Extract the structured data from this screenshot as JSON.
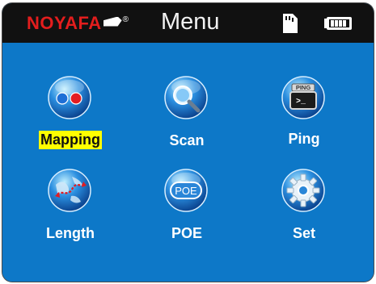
{
  "app": {
    "brand": "NOYAFA",
    "brand_mark": "®",
    "title": "Menu",
    "icons": {
      "sd_card": "sd-card-icon",
      "battery": "battery-icon"
    }
  },
  "menu": {
    "items": [
      {
        "label": "Mapping",
        "icon": "mapping-icon",
        "selected": true
      },
      {
        "label": "Scan",
        "icon": "scan-icon",
        "selected": false
      },
      {
        "label": "Ping",
        "icon": "ping-icon",
        "selected": false
      },
      {
        "label": "Length",
        "icon": "length-icon",
        "selected": false
      },
      {
        "label": "POE",
        "icon": "poe-icon",
        "selected": false
      },
      {
        "label": "Set",
        "icon": "set-icon",
        "selected": false
      }
    ]
  },
  "icon_text": {
    "ping_badge": "PING",
    "ping_prompt": ">_",
    "poe_badge": "POE"
  },
  "colors": {
    "background": "#0d78c8",
    "topbar": "#111111",
    "highlight": "#ffff00",
    "brand": "#e31d1d"
  }
}
